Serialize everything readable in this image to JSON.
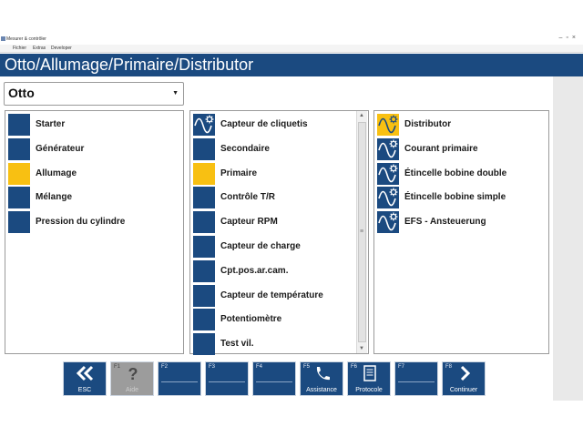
{
  "window": {
    "title": "Mesurer & contrôler",
    "menu": [
      "Fichier",
      "Extras",
      "Developer"
    ]
  },
  "header": {
    "title": "Otto/Allumage/Primaire/Distributor"
  },
  "dropdown": {
    "selected": "Otto"
  },
  "panel1": {
    "items": [
      {
        "label": "Starter",
        "selected": false
      },
      {
        "label": "Générateur",
        "selected": false
      },
      {
        "label": "Allumage",
        "selected": true
      },
      {
        "label": "Mélange",
        "selected": false
      },
      {
        "label": "Pression du cylindre",
        "selected": false
      }
    ]
  },
  "panel2": {
    "items": [
      {
        "label": "Capteur de cliquetis",
        "icon": "sine-gear-icon",
        "selected": false
      },
      {
        "label": "Secondaire",
        "selected": false
      },
      {
        "label": "Primaire",
        "selected": true
      },
      {
        "label": "Contrôle T/R",
        "selected": false
      },
      {
        "label": "Capteur RPM",
        "selected": false
      },
      {
        "label": "Capteur de charge",
        "selected": false
      },
      {
        "label": "Cpt.pos.ar.cam.",
        "selected": false
      },
      {
        "label": "Capteur de température",
        "selected": false
      },
      {
        "label": "Potentiomètre",
        "selected": false
      },
      {
        "label": "Test vil.",
        "selected": false
      }
    ]
  },
  "panel3": {
    "items": [
      {
        "label": "Distributor",
        "icon": "sine-gear-icon",
        "selected": true
      },
      {
        "label": "Courant primaire",
        "icon": "sine-gear-icon",
        "selected": false
      },
      {
        "label": "Étincelle bobine double",
        "icon": "sine-gear-icon",
        "selected": false
      },
      {
        "label": "Étincelle bobine simple",
        "icon": "sine-gear-icon",
        "selected": false
      },
      {
        "label": "EFS - Ansteuerung",
        "icon": "sine-gear-icon",
        "selected": false
      }
    ]
  },
  "fkeys": [
    {
      "num": "",
      "label": "ESC",
      "icon": "double-chevron-left-icon",
      "disabled": false
    },
    {
      "num": "F1",
      "label": "Aide",
      "icon": "question-icon",
      "disabled": true
    },
    {
      "num": "F2",
      "label": "",
      "icon": "",
      "disabled": false
    },
    {
      "num": "F3",
      "label": "",
      "icon": "",
      "disabled": false
    },
    {
      "num": "F4",
      "label": "",
      "icon": "",
      "disabled": false
    },
    {
      "num": "F5",
      "label": "Assistance",
      "icon": "phone-icon",
      "disabled": false
    },
    {
      "num": "F6",
      "label": "Protocole",
      "icon": "document-icon",
      "disabled": false
    },
    {
      "num": "F7",
      "label": "",
      "icon": "",
      "disabled": false
    },
    {
      "num": "F8",
      "label": "Continuer",
      "icon": "chevron-right-icon",
      "disabled": false
    }
  ],
  "colors": {
    "header_bg": "#1b4a80",
    "item_square": "#1b4a80",
    "selected": "#f8c012",
    "disabled_key": "#9c9c9c"
  }
}
